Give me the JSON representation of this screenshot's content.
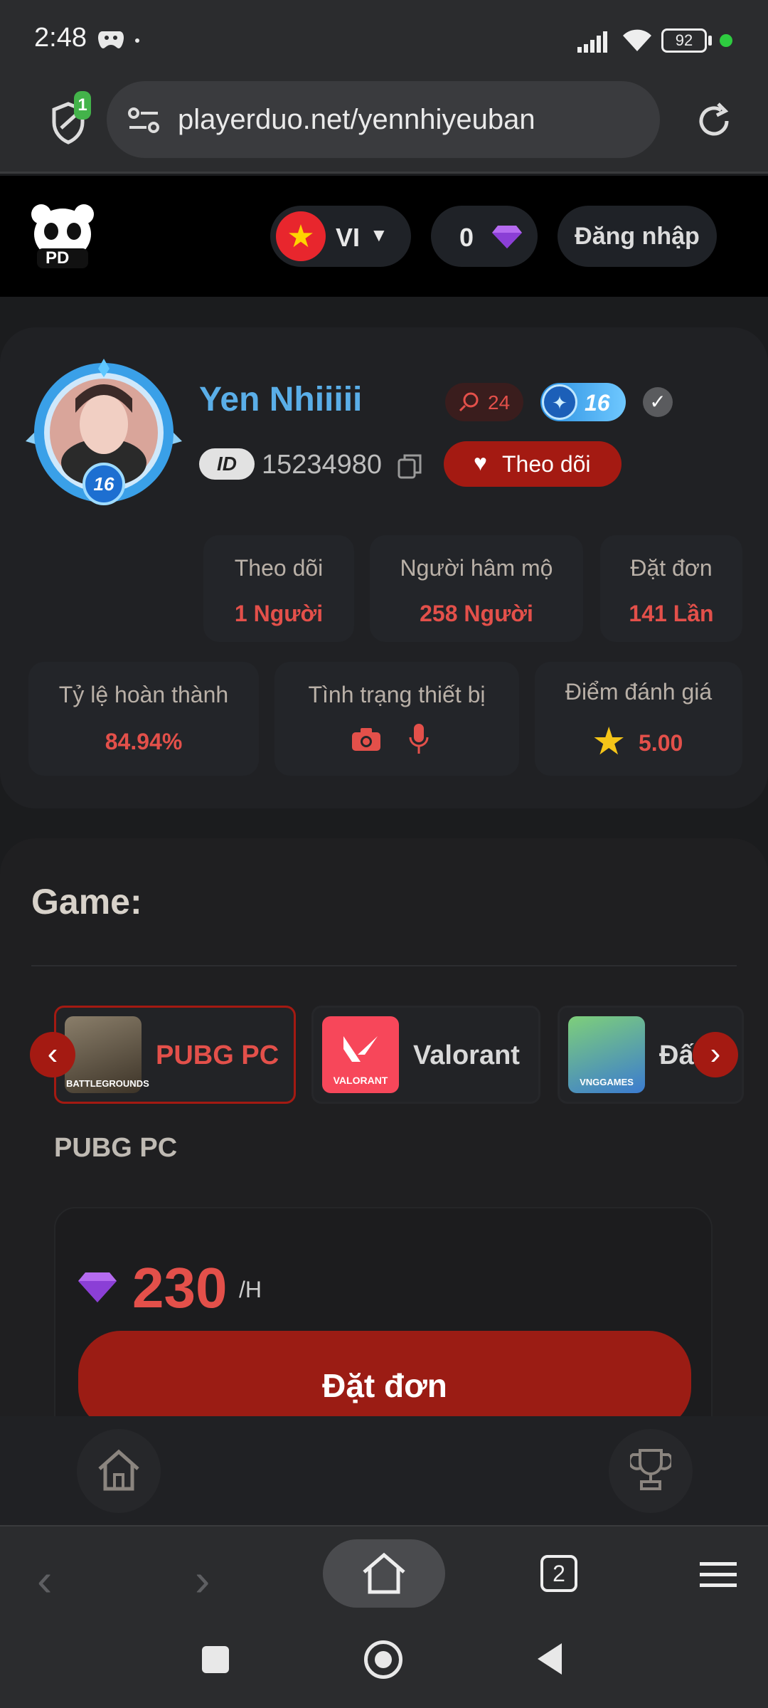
{
  "status_bar": {
    "time": "2:48",
    "battery": "92"
  },
  "browser": {
    "url": "playerduo.net/yennhiyeuban",
    "shield_badge": "1",
    "tabs_count": "2"
  },
  "site_header": {
    "logo_text": "PD",
    "language": "VI",
    "diamond_balance": "0",
    "login_label": "Đăng nhập"
  },
  "profile": {
    "name": "Yen Nhiiiii",
    "level_badge": "16",
    "avatar_level": "16",
    "comments_count": "24",
    "id_label": "ID",
    "id_value": "15234980",
    "follow_button": "Theo dõi",
    "stats": [
      {
        "label": "Theo dõi",
        "value": "1 Người"
      },
      {
        "label": "Người hâm mộ",
        "value": "258 Người"
      },
      {
        "label": "Đặt đơn",
        "value": "141 Lần"
      }
    ],
    "completion_rate_label": "Tỷ lệ hoàn thành",
    "completion_rate_value": "84.94%",
    "device_status_label": "Tình trạng thiết bị",
    "rating_label": "Điểm đánh giá",
    "rating_value": "5.00"
  },
  "games": {
    "title": "Game:",
    "items": [
      {
        "name": "PUBG PC",
        "selected": true,
        "icon_text": "BATTLEGROUNDS"
      },
      {
        "name": "Valorant",
        "selected": false,
        "icon_text": "VALORANT"
      },
      {
        "name": "Đấ",
        "selected": false,
        "icon_text": "VNGGAMES"
      }
    ],
    "selected_name": "PUBG PC",
    "price": "230",
    "price_unit": "/H",
    "order_button": "Đặt đơn"
  },
  "colors": {
    "accent_red": "#e3504a",
    "dark_red": "#9b1c14",
    "name_blue": "#5aaee8"
  }
}
